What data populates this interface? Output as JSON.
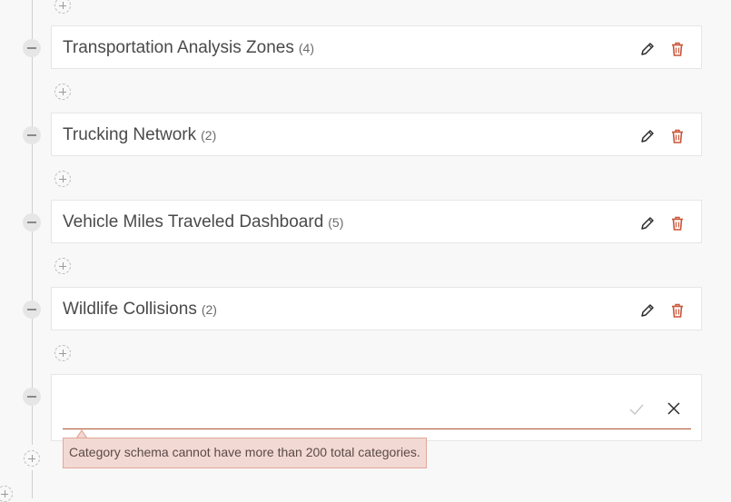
{
  "categories": [
    {
      "name": "Transportation Analysis Zones",
      "count": "(4)"
    },
    {
      "name": "Trucking Network",
      "count": "(2)"
    },
    {
      "name": "Vehicle Miles Traveled Dashboard",
      "count": "(5)"
    },
    {
      "name": "Wildlife Collisions",
      "count": "(2)"
    }
  ],
  "new_category": {
    "value": "",
    "placeholder": "",
    "error_message": "Category schema cannot have more than 200 total categories."
  },
  "icons": {
    "collapse": "minus-circle-icon",
    "add": "plus-circle-icon",
    "edit": "pencil-icon",
    "delete": "trash-icon",
    "confirm": "check-icon",
    "cancel": "x-icon"
  },
  "colors": {
    "delete": "#c8563a",
    "error_background": "#f3d9d3",
    "input_underline": "#b5532e"
  }
}
